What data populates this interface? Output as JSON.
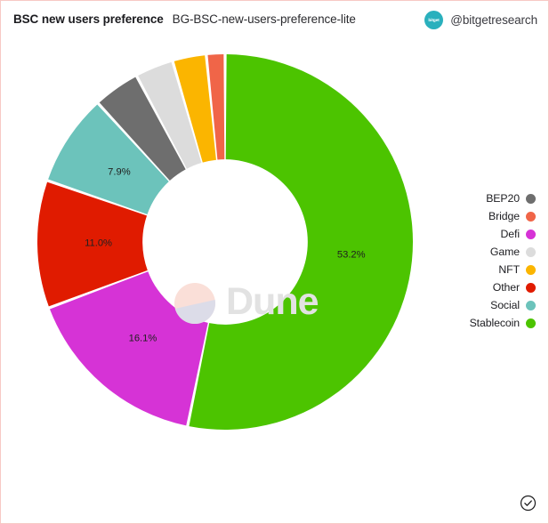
{
  "header": {
    "title": "BSC new users preference",
    "subtitle": "BG-BSC-new-users-preference-lite",
    "brand_badge_text": "bitget",
    "brand_handle": "@bitgetresearch",
    "badge_color": "#2ab0bd"
  },
  "watermark": {
    "text": "Dune",
    "mark_top_color": "#fadfd8",
    "mark_bottom_color": "#dcdce8",
    "text_color": "#e2e2e2"
  },
  "footer": {
    "verified_icon": "check-circle-icon"
  },
  "chart_data": {
    "type": "pie",
    "title": "BSC new users preference",
    "subtitle": "BG-BSC-new-users-preference-lite",
    "donut": true,
    "inner_radius_ratio": 0.44,
    "start_angle_deg": 0,
    "direction": "clockwise",
    "legend_position": "right",
    "grid": false,
    "xlabel": "",
    "ylabel": "",
    "categories": [
      "Stablecoin",
      "Defi",
      "Other",
      "Social",
      "BEP20",
      "Game",
      "NFT",
      "Bridge"
    ],
    "values": [
      53.2,
      16.1,
      11.0,
      7.9,
      4.0,
      3.3,
      2.9,
      1.6
    ],
    "colors": [
      "#4cc400",
      "#d633d6",
      "#e01b00",
      "#6cc3bb",
      "#6e6e6e",
      "#dcdcdc",
      "#fbb500",
      "#f06548"
    ],
    "slices": [
      {
        "label": "Stablecoin",
        "value": 53.2,
        "display": "53.2%",
        "color": "#4cc400",
        "labeled": true
      },
      {
        "label": "Defi",
        "value": 16.1,
        "display": "16.1%",
        "color": "#d633d6",
        "labeled": true
      },
      {
        "label": "Other",
        "value": 11.0,
        "display": "11.0%",
        "color": "#e01b00",
        "labeled": true
      },
      {
        "label": "Social",
        "value": 7.9,
        "display": "7.9%",
        "color": "#6cc3bb",
        "labeled": true
      },
      {
        "label": "BEP20",
        "value": 4.0,
        "display": "",
        "color": "#6e6e6e",
        "labeled": false
      },
      {
        "label": "Game",
        "value": 3.3,
        "display": "",
        "color": "#dcdcdc",
        "labeled": false
      },
      {
        "label": "NFT",
        "value": 2.9,
        "display": "",
        "color": "#fbb500",
        "labeled": false
      },
      {
        "label": "Bridge",
        "value": 1.6,
        "display": "",
        "color": "#f06548",
        "labeled": false
      }
    ],
    "legend": [
      {
        "label": "BEP20",
        "color": "#6e6e6e"
      },
      {
        "label": "Bridge",
        "color": "#f06548"
      },
      {
        "label": "Defi",
        "color": "#d633d6"
      },
      {
        "label": "Game",
        "color": "#dcdcdc"
      },
      {
        "label": "NFT",
        "color": "#fbb500"
      },
      {
        "label": "Other",
        "color": "#e01b00"
      },
      {
        "label": "Social",
        "color": "#6cc3bb"
      },
      {
        "label": "Stablecoin",
        "color": "#4cc400"
      }
    ]
  }
}
